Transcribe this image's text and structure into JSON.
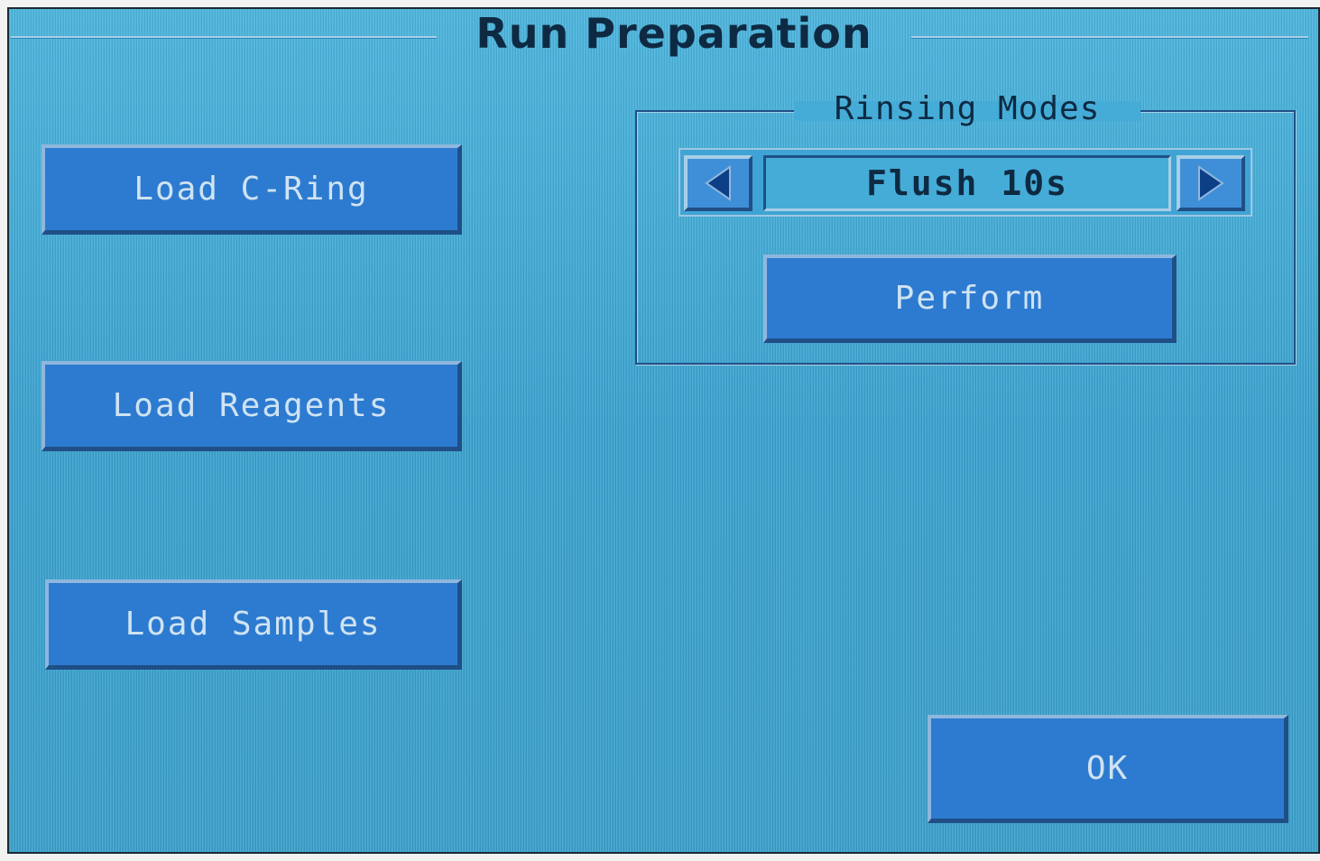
{
  "screen": {
    "title": "Run Preparation"
  },
  "left_buttons": {
    "load_cring": "Load C-Ring",
    "load_reagents": "Load Reagents",
    "load_samples": "Load Samples"
  },
  "rinsing": {
    "group_label": "Rinsing Modes",
    "selected_mode": "Flush 10s",
    "prev_icon": "triangle-left-icon",
    "next_icon": "triangle-right-icon",
    "perform_label": "Perform"
  },
  "footer": {
    "ok_label": "OK"
  },
  "colors": {
    "background": "#3ea6d4",
    "button": "#2d7bd0",
    "button_text": "#cfe3f2",
    "title_text": "#0e2a42"
  }
}
